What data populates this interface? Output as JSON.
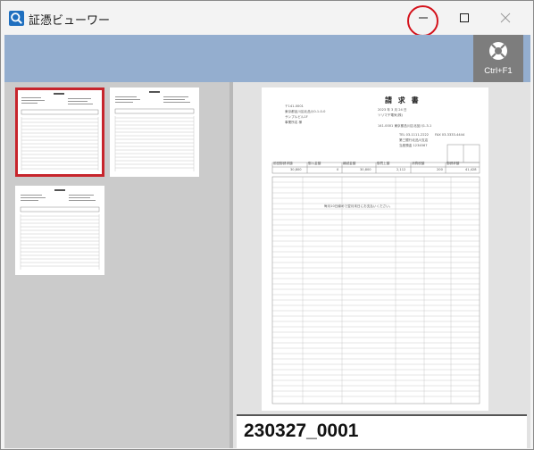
{
  "window": {
    "title": "証憑ビューワー"
  },
  "toolbar": {
    "shortcut_label": "Ctrl+F1"
  },
  "thumbnails": [
    {
      "name": "thumb-page-1",
      "selected": true
    },
    {
      "name": "thumb-page-2",
      "selected": false
    },
    {
      "name": "thumb-page-3",
      "selected": false
    }
  ],
  "preview": {
    "filename": "230327_0001",
    "document": {
      "title": "請 求 書",
      "postal_code": "〒141-0001",
      "sender_address": "東京都品川区北品川0-1-0-0",
      "recipient_company": "サンプルビル1F",
      "recipient_name": "事業所名 様",
      "date": "2023 年 3 月 24 日",
      "issuer": "ソリマチ電気(株)",
      "issuer_address": "141-0001 東京都品川区北品川1-3-1",
      "tel": "TEL 03-1111-2222",
      "fax": "FAX 03-3333-4444",
      "bank": "第三銀行北品川支店",
      "account": "当座預金 1234567",
      "headers": [
        "前回御請求額",
        "御入金額",
        "繰越金額",
        "御買上額",
        "消費税額",
        "御請求額"
      ],
      "amounts": [
        "30,800",
        "0",
        "30,800",
        "2,112",
        "200",
        "41,428"
      ],
      "note": "毎月10日締めで翌月末日にお支払いください。"
    }
  }
}
